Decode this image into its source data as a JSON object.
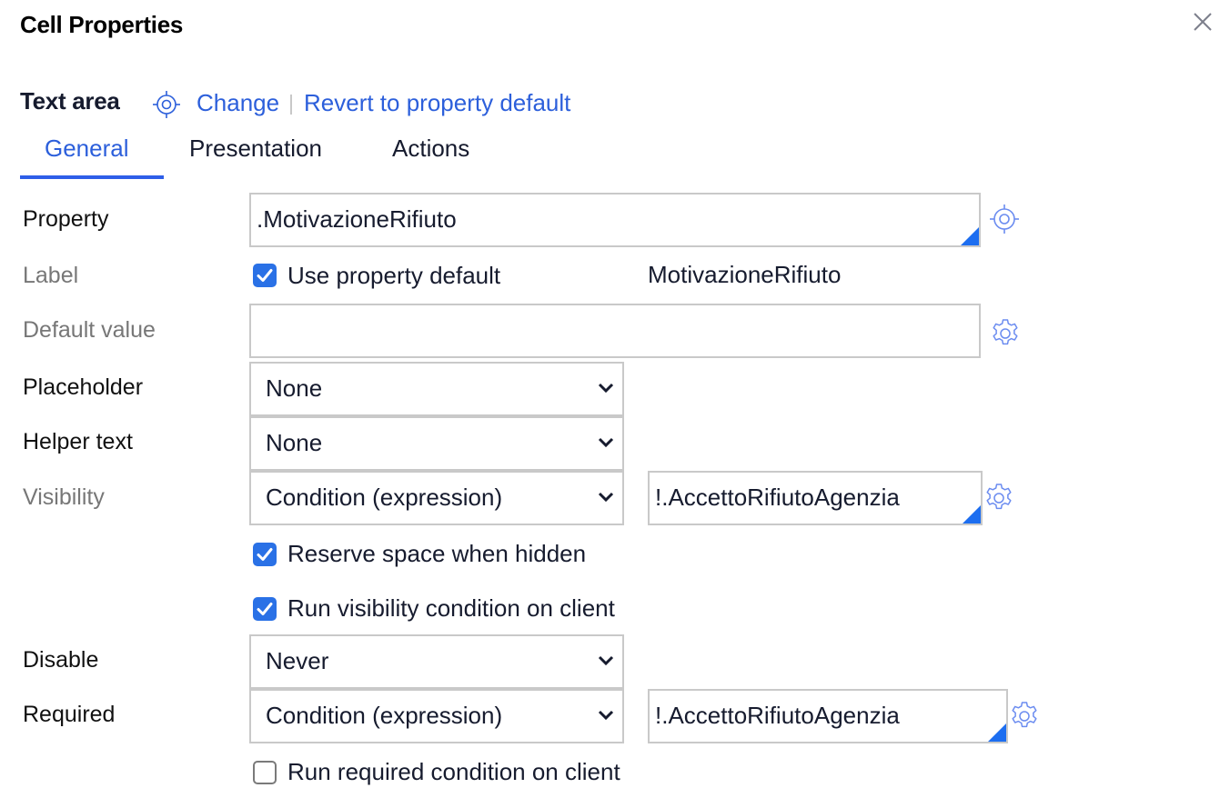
{
  "dialog": {
    "title": "Cell Properties",
    "close_icon": "close-icon"
  },
  "control": {
    "type": "Text area",
    "change_link": "Change",
    "separator": "|",
    "revert_link": "Revert to property default"
  },
  "tabs": [
    {
      "label": "General",
      "active": true
    },
    {
      "label": "Presentation",
      "active": false
    },
    {
      "label": "Actions",
      "active": false
    }
  ],
  "fields": {
    "property": {
      "label": "Property",
      "value": ".MotivazioneRifiuto",
      "icon": "crosshair-icon"
    },
    "label": {
      "label": "Label",
      "checkbox_label": "Use property default",
      "checked": true,
      "default_value": "MotivazioneRifiuto"
    },
    "default_value": {
      "label": "Default value",
      "value": "",
      "icon": "gear-icon"
    },
    "placeholder": {
      "label": "Placeholder",
      "selected": "None"
    },
    "helper_text": {
      "label": "Helper text",
      "selected": "None"
    },
    "visibility": {
      "label": "Visibility",
      "selected": "Condition (expression)",
      "expression": "!.AccettoRifiutoAgenzia",
      "icon": "gear-icon",
      "reserve_space": {
        "label": "Reserve space when hidden",
        "checked": true
      },
      "run_on_client": {
        "label": "Run visibility condition on client",
        "checked": true
      }
    },
    "disable": {
      "label": "Disable",
      "selected": "Never"
    },
    "required": {
      "label": "Required",
      "selected": "Condition (expression)",
      "expression": "!.AccettoRifiutoAgenzia",
      "icon": "gear-icon",
      "run_on_client": {
        "label": "Run required condition on client",
        "checked": false
      }
    }
  },
  "colors": {
    "accent": "#2c5fdb",
    "checkbox": "#2a71e6",
    "icon": "#6b8cf0",
    "corner": "#1d6ef0"
  }
}
